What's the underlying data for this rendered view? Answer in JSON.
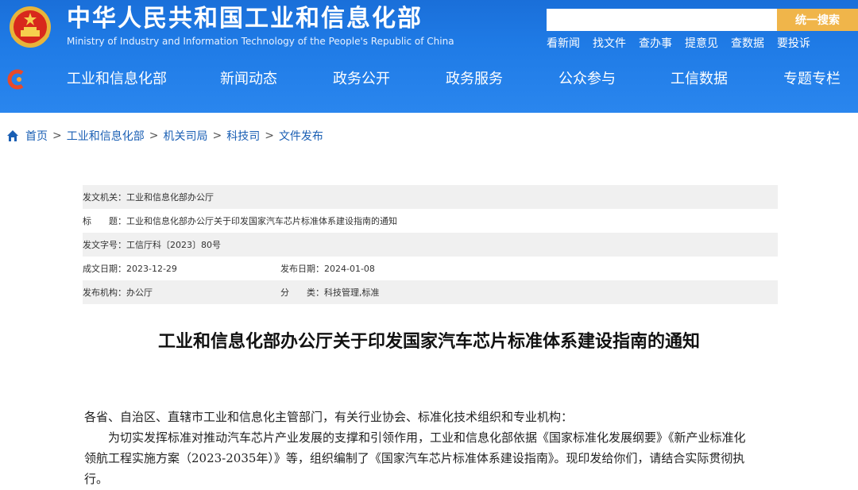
{
  "header": {
    "title": "中华人民共和国工业和信息化部",
    "subtitle": "Ministry of Industry and Information Technology of the People's Republic of China",
    "search_placeholder": "",
    "search_button": "统一搜索",
    "quick_links": [
      "看新闻",
      "找文件",
      "查办事",
      "提意见",
      "查数据",
      "要投诉"
    ]
  },
  "nav": {
    "items": [
      "工业和信息化部",
      "新闻动态",
      "政务公开",
      "政务服务",
      "公众参与",
      "工信数据",
      "专题专栏"
    ]
  },
  "breadcrumb": [
    "首页",
    "工业和信息化部",
    "机关司局",
    "科技司",
    "文件发布"
  ],
  "meta": {
    "issuer_label": "发文机关：",
    "issuer": "工业和信息化部办公厅",
    "subject_label": "标　　题：",
    "subject": "工业和信息化部办公厅关于印发国家汽车芯片标准体系建设指南的通知",
    "doc_no_label": "发文字号：",
    "doc_no": "工信厅科〔2023〕80号",
    "created_label": "成文日期：",
    "created": "2023-12-29",
    "published_label": "发布日期：",
    "published": "2024-01-08",
    "org_label": "发布机构：",
    "org": "办公厅",
    "category_label": "分　　类：",
    "category": "科技管理,标准"
  },
  "article": {
    "title": "工业和信息化部办公厅关于印发国家汽车芯片标准体系建设指南的通知",
    "salutation": "各省、自治区、直辖市工业和信息化主管部门，有关行业协会、标准化技术组织和专业机构：",
    "body_lines": [
      "　　为切实发挥标准对推动汽车芯片产业发展的支撑和引领作用，工业和信息化部依据《国家标准化发展纲要》《新产业标准化",
      "领航工程实施方案（2023-2035年）》等，组织编制了《国家汽车芯片标准体系建设指南》。现印发给你们，请结合实际贯彻执",
      "行。"
    ]
  },
  "colors": {
    "header_blue": "#1f7be6",
    "search_button": "#f0b54a",
    "link_blue": "#1a5fb4"
  }
}
